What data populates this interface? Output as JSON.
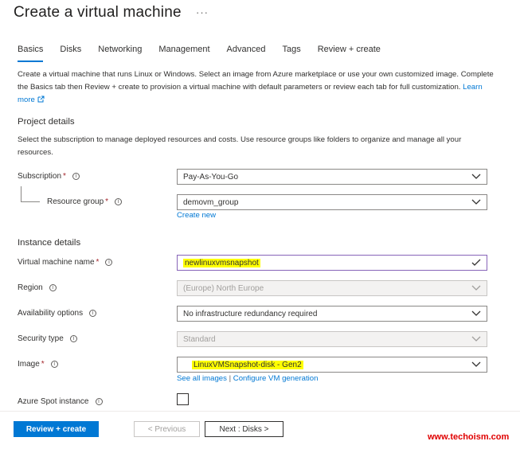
{
  "header": {
    "title": "Create a virtual machine",
    "more": "···"
  },
  "tabs": [
    "Basics",
    "Disks",
    "Networking",
    "Management",
    "Advanced",
    "Tags",
    "Review + create"
  ],
  "intro": {
    "text": "Create a virtual machine that runs Linux or Windows. Select an image from Azure marketplace or use your own customized image. Complete the Basics tab then Review + create to provision a virtual machine with default parameters or review each tab for full customization.",
    "learn_more": "Learn more"
  },
  "project": {
    "heading": "Project details",
    "description": "Select the subscription to manage deployed resources and costs. Use resource groups like folders to organize and manage all your resources.",
    "subscription_label": "Subscription",
    "subscription_value": "Pay-As-You-Go",
    "resource_group_label": "Resource group",
    "resource_group_value": "demovm_group",
    "create_new": "Create new"
  },
  "instance": {
    "heading": "Instance details",
    "vm_name_label": "Virtual machine name",
    "vm_name_value": "newlinuxvmsnapshot",
    "region_label": "Region",
    "region_value": "(Europe) North Europe",
    "availability_label": "Availability options",
    "availability_value": "No infrastructure redundancy required",
    "security_label": "Security type",
    "security_value": "Standard",
    "image_label": "Image",
    "image_value": "LinuxVMSnapshot-disk - Gen2",
    "see_all_images": "See all images",
    "separator": "|",
    "configure_vm": "Configure VM generation",
    "spot_label": "Azure Spot instance"
  },
  "footer": {
    "review_create": "Review + create",
    "previous": "< Previous",
    "next": "Next : Disks >"
  },
  "watermark": "www.techoism.com",
  "colors": {
    "accent": "#0078d4",
    "required": "#a4262c",
    "highlight": "#ffff00",
    "valid_border": "#8764b8",
    "watermark": "#e00000"
  }
}
